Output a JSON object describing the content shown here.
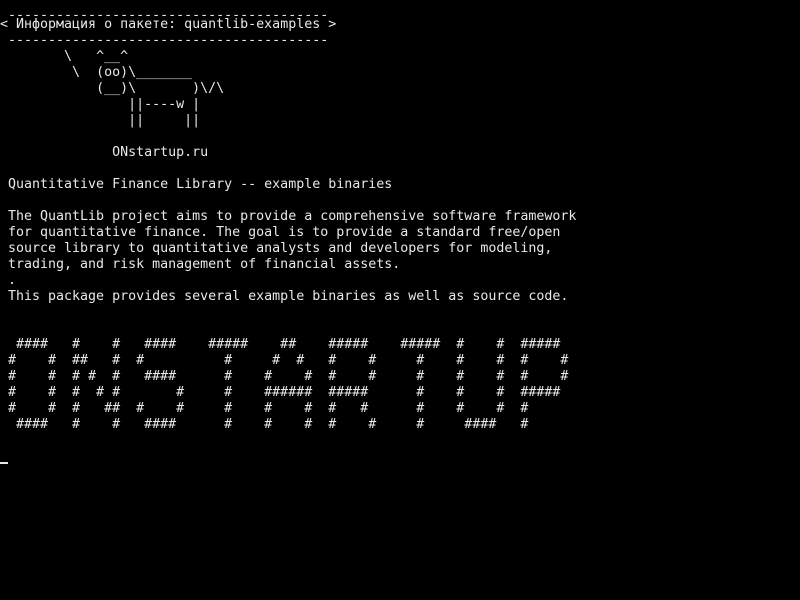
{
  "terminal": {
    "bubble_border_top": " ----------------------------------------",
    "bubble_text": "< Информация о пакете: quantlib-examples >",
    "bubble_border_bottom": " ----------------------------------------",
    "cow_art": "        \\   ^__^\n         \\  (oo)\\_______\n            (__)\\       )\\/\\\n                ||----w |\n                ||     ||",
    "site_label": "             ONstartup.ru",
    "package_summary": "Quantitative Finance Library -- example binaries",
    "description": "The QuantLib project aims to provide a comprehensive software framework\nfor quantitative finance. The goal is to provide a standard free/open\nsource library to quantitative analysts and developers for modeling,\ntrading, and risk management of financial assets.\n.\nThis package provides several example binaries as well as source code.",
    "figlet_banner": " ####   #    #   ####    #####    ##    #####    #####  #    #  #####\n#    #  ##   #  #          #     #  #   #    #     #    #    #  #    #\n#    #  # #  #   ####      #    #    #  #    #     #    #    #  #    #\n#    #  #  # #       #     #    ######  #####      #    #    #  #####\n#    #  #   ##  #    #     #    #    #  #   #      #    #    #  #\n ####   #    #   ####      #    #    #  #    #     #     ####   #"
  }
}
